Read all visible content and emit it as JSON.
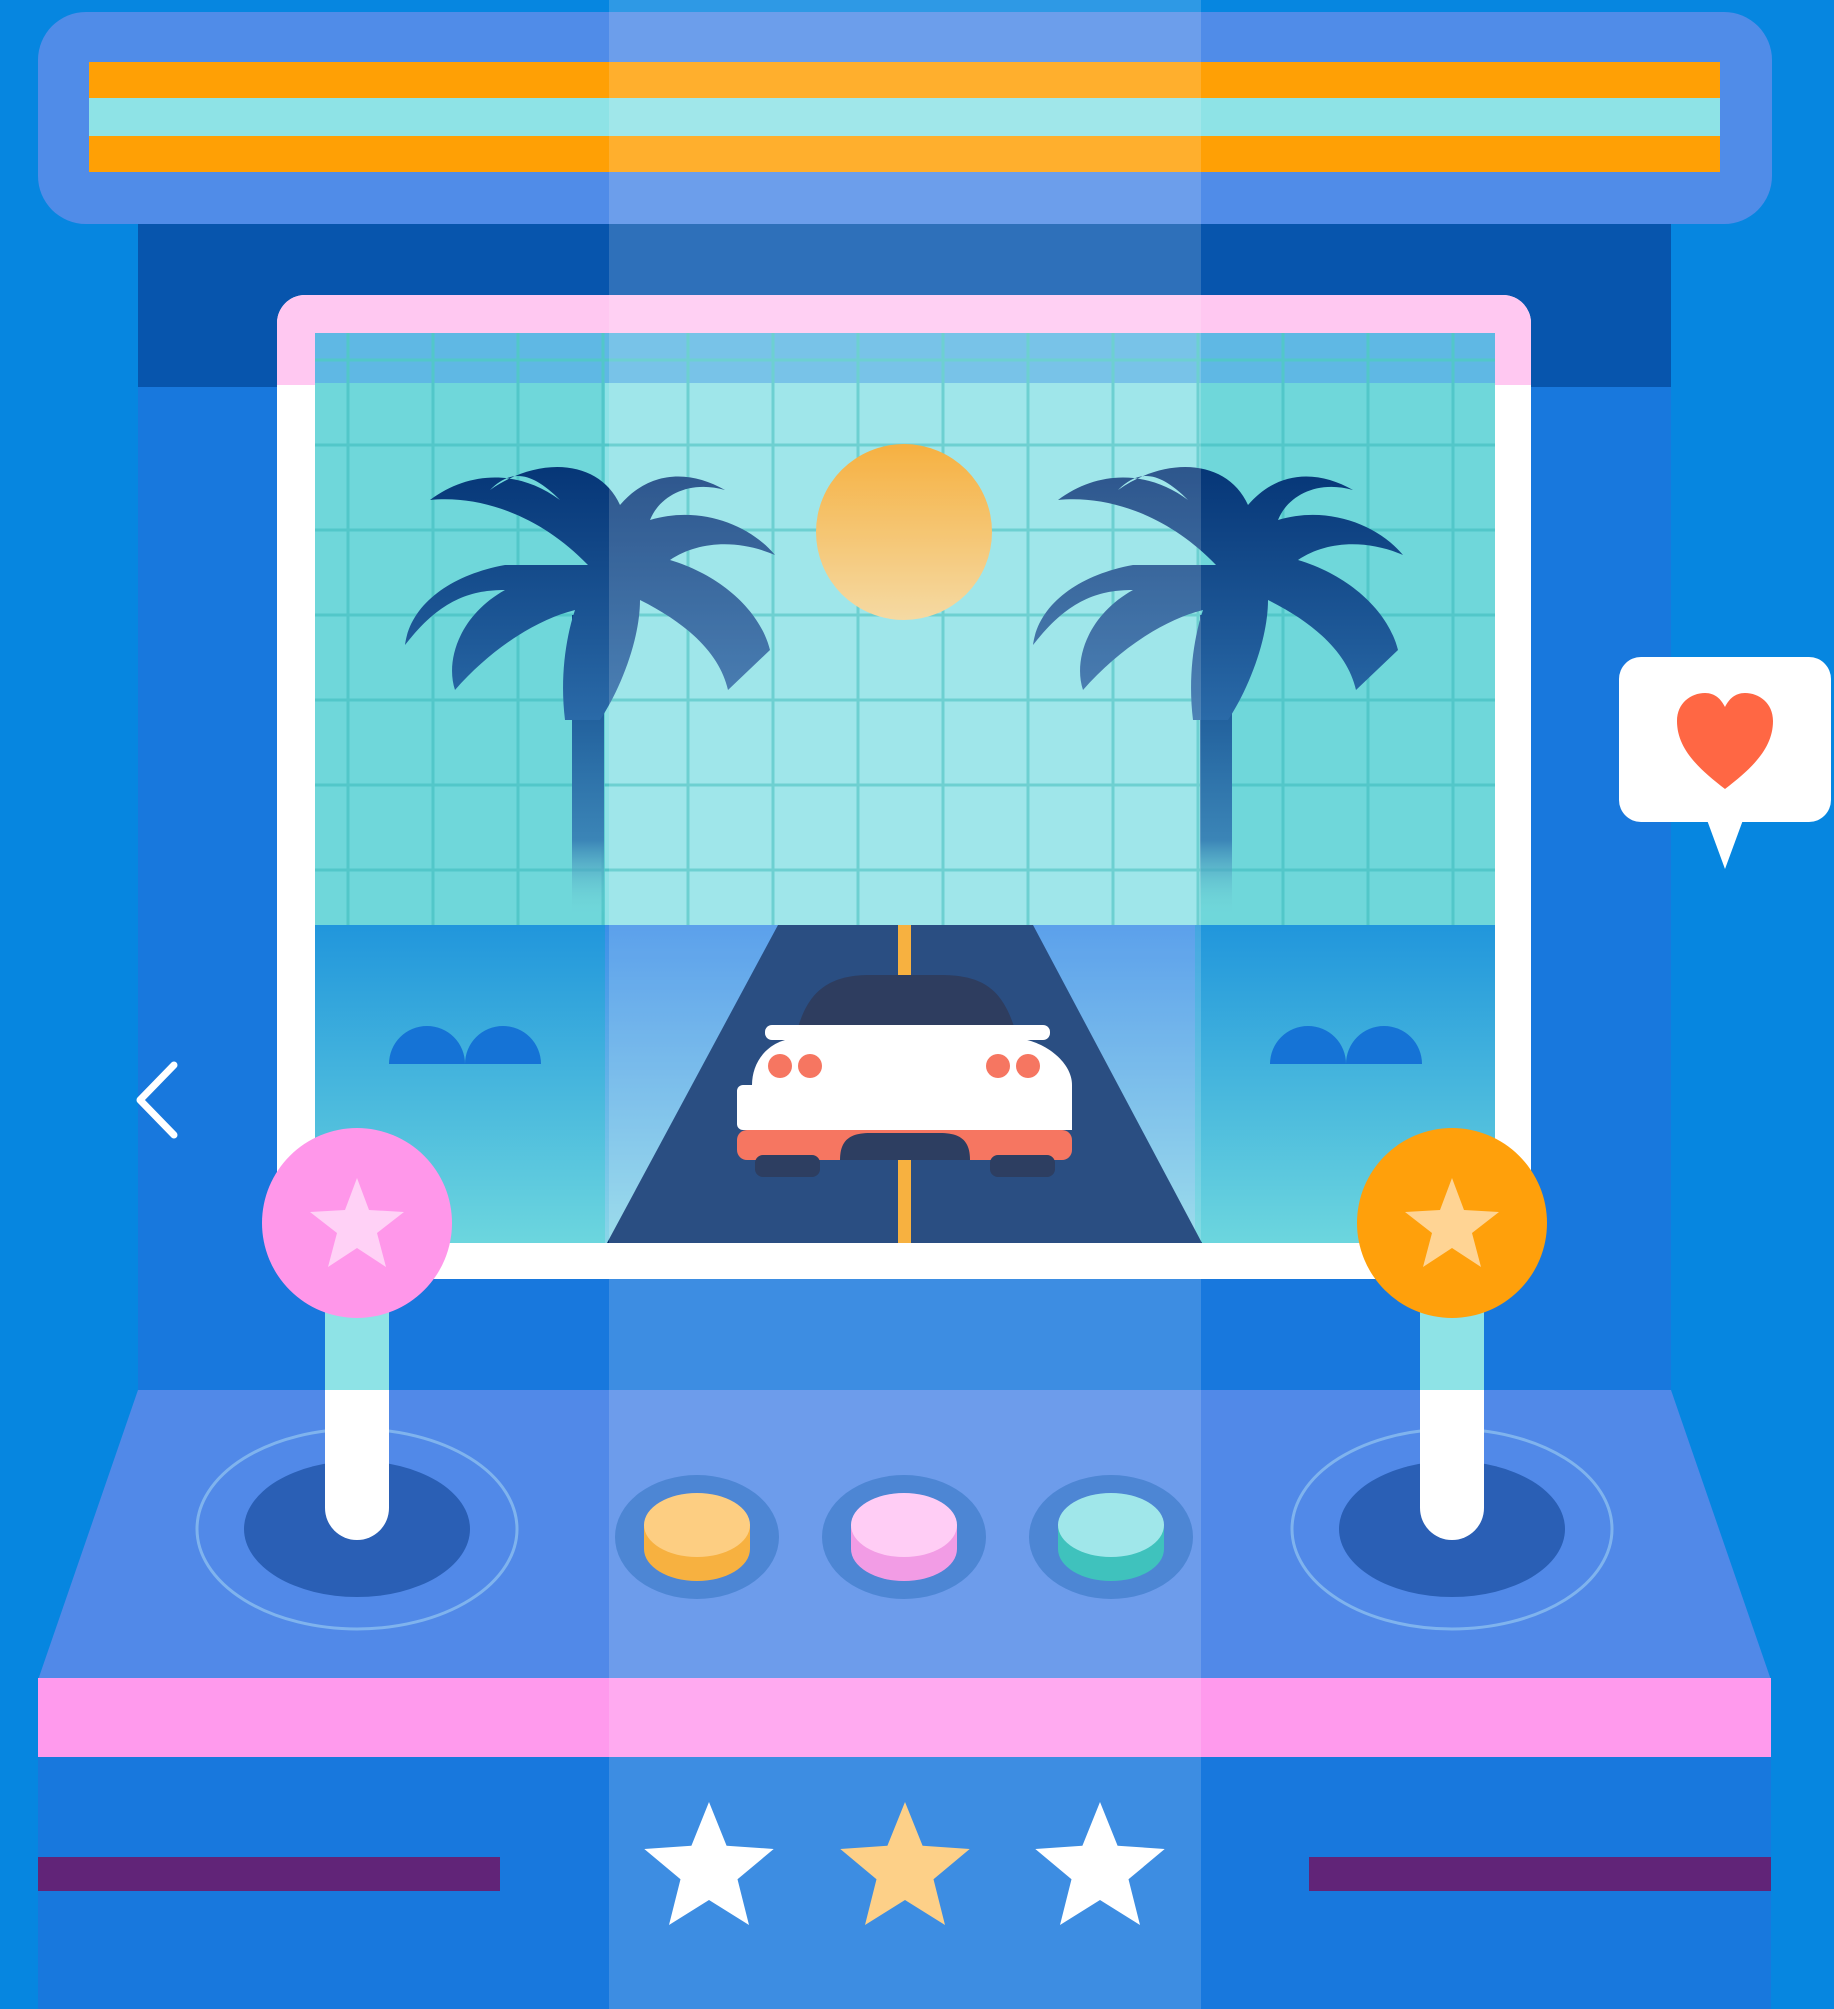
{
  "colors": {
    "page_background": "#0686e0",
    "cabinet_body": "#1878dd",
    "marquee_frame": "#508ce8",
    "marquee_stripe_orange": "#ffa005",
    "marquee_stripe_cyan": "#8ee3e6",
    "screen_bezel": "#ffffff",
    "screen_top_accent": "#ffc8f1",
    "sky": "#8de2e6",
    "road": "#022d6b",
    "control_panel": "#5189e8",
    "pink_trim": "#ff9aed",
    "purple_slot": "#612478",
    "joystick_left_ball": "#ff97ea",
    "joystick_right_ball": "#ffa00b",
    "heart": "#ff6744",
    "star_gold": "#fdc872",
    "star_white": "#ffffff"
  },
  "icons": {
    "back": "chevron-left-icon",
    "like": "heart-icon",
    "joystick_left_ball": "star-icon",
    "joystick_right_ball": "star-icon"
  },
  "arcade_buttons": [
    {
      "name": "yellow",
      "top": "#fdc56a",
      "side": "#f6a21c"
    },
    {
      "name": "pink",
      "top": "#ffc4f3",
      "side": "#f08ae0"
    },
    {
      "name": "teal",
      "top": "#8ee3e6",
      "side": "#1bb7b1"
    }
  ],
  "rating": {
    "stars": [
      "star-white",
      "star-gold",
      "star-white"
    ]
  }
}
